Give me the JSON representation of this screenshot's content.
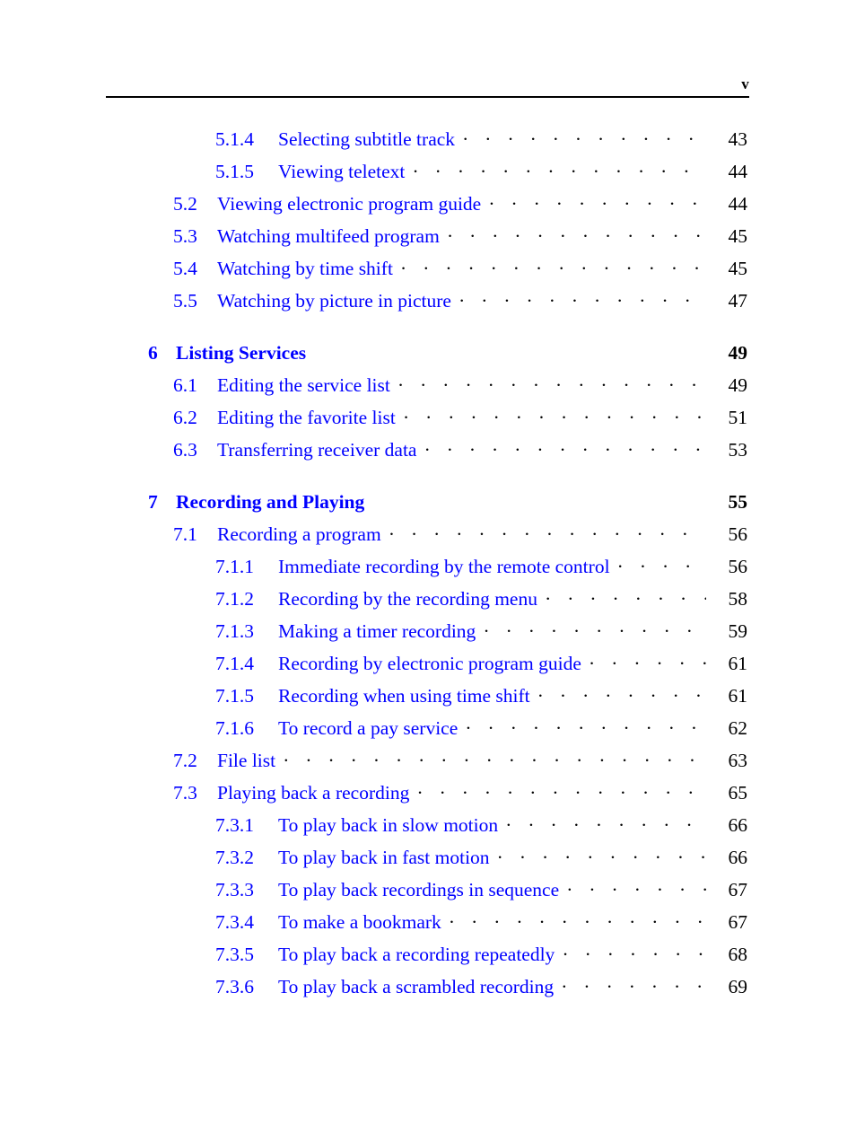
{
  "header": {
    "folio": "v"
  },
  "colors": {
    "entry_blue": "#0000FF",
    "leader_black": "#000000",
    "folio_black": "#000000",
    "rule_black": "#000000"
  },
  "toc": {
    "entries": [
      {
        "level": "subsection",
        "number": "5.1.4",
        "title": "Selecting subtitle track",
        "page": "43"
      },
      {
        "level": "subsection",
        "number": "5.1.5",
        "title": "Viewing teletext",
        "page": "44"
      },
      {
        "level": "section",
        "number": "5.2",
        "title": "Viewing electronic program guide",
        "page": "44"
      },
      {
        "level": "section",
        "number": "5.3",
        "title": "Watching multifeed program",
        "page": "45"
      },
      {
        "level": "section",
        "number": "5.4",
        "title": "Watching by time shift",
        "page": "45"
      },
      {
        "level": "section",
        "number": "5.5",
        "title": "Watching by picture in picture",
        "page": "47"
      },
      {
        "level": "chapter",
        "number": "6",
        "title": "Listing Services",
        "page": "49"
      },
      {
        "level": "section",
        "number": "6.1",
        "title": "Editing the service list",
        "page": "49"
      },
      {
        "level": "section",
        "number": "6.2",
        "title": "Editing the favorite list",
        "page": "51"
      },
      {
        "level": "section",
        "number": "6.3",
        "title": "Transferring receiver data",
        "page": "53"
      },
      {
        "level": "chapter",
        "number": "7",
        "title": "Recording and Playing",
        "page": "55"
      },
      {
        "level": "section",
        "number": "7.1",
        "title": "Recording a program",
        "page": "56"
      },
      {
        "level": "subsection",
        "number": "7.1.1",
        "title": "Immediate recording by the remote control",
        "page": "56"
      },
      {
        "level": "subsection",
        "number": "7.1.2",
        "title": "Recording by the recording menu",
        "page": "58"
      },
      {
        "level": "subsection",
        "number": "7.1.3",
        "title": "Making a timer recording",
        "page": "59"
      },
      {
        "level": "subsection",
        "number": "7.1.4",
        "title": "Recording by electronic program guide",
        "page": "61"
      },
      {
        "level": "subsection",
        "number": "7.1.5",
        "title": "Recording when using time shift",
        "page": "61"
      },
      {
        "level": "subsection",
        "number": "7.1.6",
        "title": "To record a pay service",
        "page": "62"
      },
      {
        "level": "section",
        "number": "7.2",
        "title": "File list",
        "page": "63"
      },
      {
        "level": "section",
        "number": "7.3",
        "title": "Playing back a recording",
        "page": "65"
      },
      {
        "level": "subsection",
        "number": "7.3.1",
        "title": "To play back in slow motion",
        "page": "66"
      },
      {
        "level": "subsection",
        "number": "7.3.2",
        "title": "To play back in fast motion",
        "page": "66"
      },
      {
        "level": "subsection",
        "number": "7.3.3",
        "title": "To play back recordings in sequence",
        "page": "67"
      },
      {
        "level": "subsection",
        "number": "7.3.4",
        "title": "To make a bookmark",
        "page": "67"
      },
      {
        "level": "subsection",
        "number": "7.3.5",
        "title": "To play back a recording repeatedly",
        "page": "68"
      },
      {
        "level": "subsection",
        "number": "7.3.6",
        "title": "To play back a scrambled recording",
        "page": "69"
      }
    ]
  }
}
